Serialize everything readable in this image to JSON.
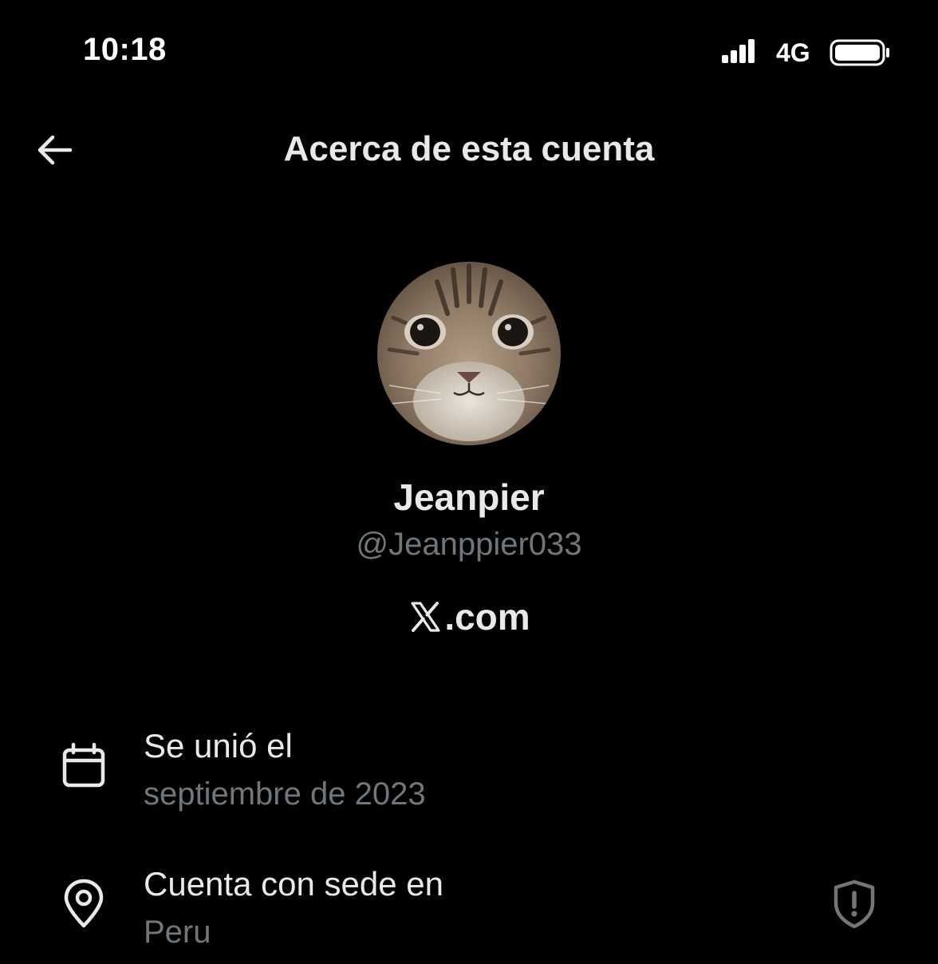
{
  "status_bar": {
    "time": "10:18",
    "network": "4G",
    "signal_icon": "cellular-signal-icon",
    "battery_icon": "battery-icon"
  },
  "header": {
    "back_icon": "arrow-left-icon",
    "title": "Acerca de esta cuenta"
  },
  "profile": {
    "avatar": "cat-avatar",
    "display_name": "Jeanpier",
    "handle": "@Jeanppier033",
    "platform_logo": "x-logo-icon",
    "platform_text": ".com"
  },
  "details": [
    {
      "icon": "calendar-icon",
      "label": "Se unió el",
      "value": "septiembre de 2023"
    },
    {
      "icon": "location-pin-icon",
      "label": "Cuenta con sede en",
      "value": "Peru",
      "trailing_icon": "shield-alert-icon"
    }
  ],
  "colors": {
    "background": "#000000",
    "primary_text": "#e7e9ea",
    "secondary_text": "#71767b"
  }
}
